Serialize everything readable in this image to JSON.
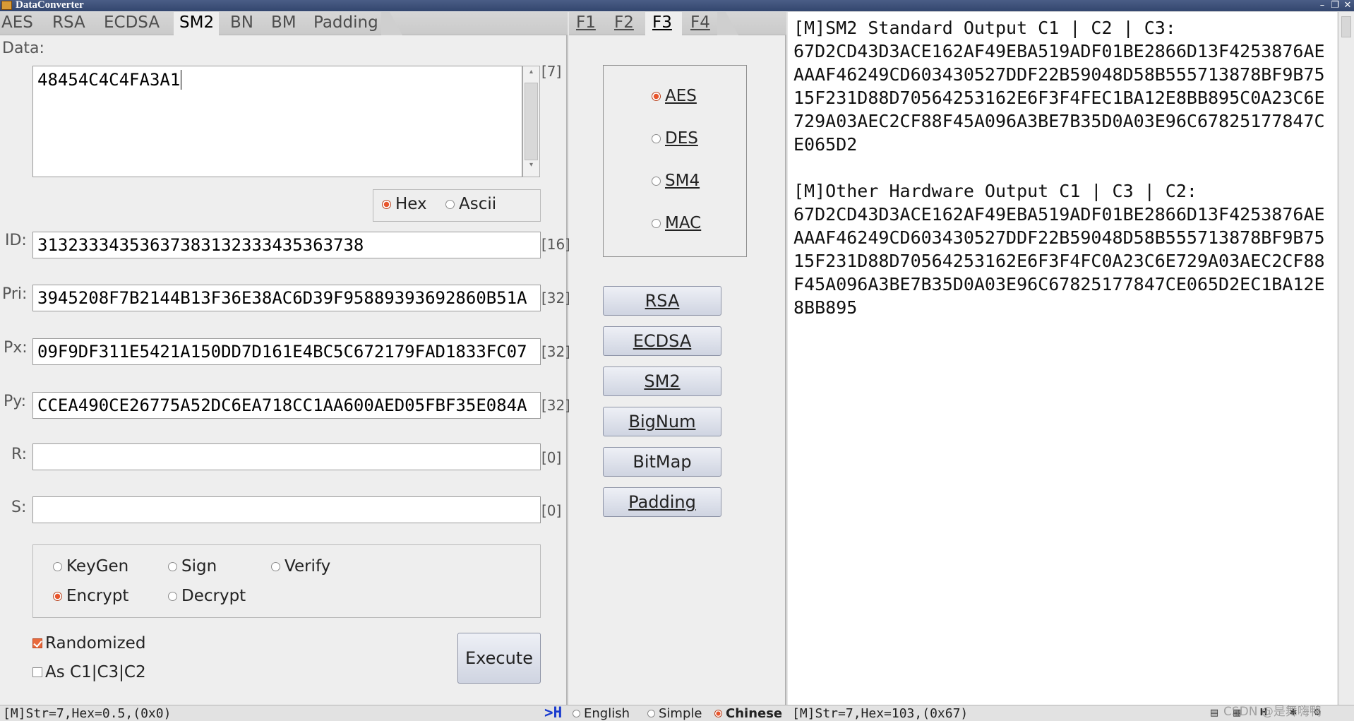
{
  "window": {
    "title": "DataConverter"
  },
  "left_tabs": [
    {
      "label": "AES",
      "active": false
    },
    {
      "label": "RSA",
      "active": false
    },
    {
      "label": "ECDSA",
      "active": false
    },
    {
      "label": "SM2",
      "active": true
    },
    {
      "label": "BN",
      "active": false
    },
    {
      "label": "BM",
      "active": false
    },
    {
      "label": "Padding",
      "active": false
    }
  ],
  "mid_tabs": [
    {
      "label": "F1",
      "active": false
    },
    {
      "label": "F2",
      "active": false
    },
    {
      "label": "F3",
      "active": true
    },
    {
      "label": "F4",
      "active": false
    }
  ],
  "form": {
    "data_label": "Data:",
    "data_value": "48454C4C4FA3A1",
    "data_count": "[7]",
    "format": {
      "hex": "Hex",
      "ascii": "Ascii",
      "selected": "Hex"
    },
    "id_label": "ID:",
    "id_value": "31323334353637383132333435363738",
    "id_count": "[16]",
    "pri_label": "Pri:",
    "pri_value": "3945208F7B2144B13F36E38AC6D39F95889393692860B51A",
    "pri_count": "[32]",
    "px_label": "Px:",
    "px_value": "09F9DF311E5421A150DD7D161E4BC5C672179FAD1833FC07",
    "px_count": "[32]",
    "py_label": "Py:",
    "py_value": "CCEA490CE26775A52DC6EA718CC1AA600AED05FBF35E084A",
    "py_count": "[32]",
    "r_label": "R:",
    "r_value": "",
    "r_count": "[0]",
    "s_label": "S:",
    "s_value": "",
    "s_count": "[0]",
    "ops": {
      "keygen": "KeyGen",
      "sign": "Sign",
      "verify": "Verify",
      "encrypt": "Encrypt",
      "decrypt": "Decrypt",
      "selected": "Encrypt"
    },
    "randomized": {
      "label": "Randomized",
      "checked": true
    },
    "as_c1c3c2": {
      "label": "As C1|C3|C2",
      "checked": false
    },
    "execute_label": "Execute"
  },
  "mid": {
    "algos": [
      "AES",
      "DES",
      "SM4",
      "MAC"
    ],
    "algo_selected": "AES",
    "buttons": [
      "RSA",
      "ECDSA",
      "SM2",
      "BigNum",
      "BitMap",
      "Padding"
    ]
  },
  "output": {
    "text": "[M]SM2 Standard Output C1 | C2 | C3:\n67D2CD43D3ACE162AF49EBA519ADF01BE2866D13F4253876AEAAAF46249CD603430527DDF22B59048D58B555713878BF9B7515F231D88D70564253162E6F3F4FEC1BA12E8BB895C0A23C6E729A03AEC2CF88F45A096A3BE7B35D0A03E96C67825177847CE065D2\n\n[M]Other Hardware Output C1 | C3 | C2:\n67D2CD43D3ACE162AF49EBA519ADF01BE2866D13F4253876AEAAAF46249CD603430527DDF22B59048D58B555713878BF9B7515F231D88D70564253162E6F3F4FC0A23C6E729A03AEC2CF88F45A096A3BE7B35D0A03E96C67825177847CE065D2EC1BA12E8BB895"
  },
  "status": {
    "left": "[M]Str=7,Hex=0.5,(0x0)",
    "h_marker": ">H",
    "languages": [
      "English",
      "Simple",
      "Chinese"
    ],
    "language_selected": "Chinese",
    "right": "[M]Str=7,Hex=103,(0x67)",
    "watermark": "CSDN @是舞嗨鸭"
  },
  "icons": [
    "app-icon",
    "minimize-icon",
    "restore-icon",
    "close-icon",
    "save-icon",
    "calculator-icon",
    "hex-icon",
    "bug-icon",
    "gear-icon"
  ],
  "colors": {
    "accent": "#e8552c",
    "titlebar": "#3a4d78",
    "panel": "#eeeeee"
  }
}
